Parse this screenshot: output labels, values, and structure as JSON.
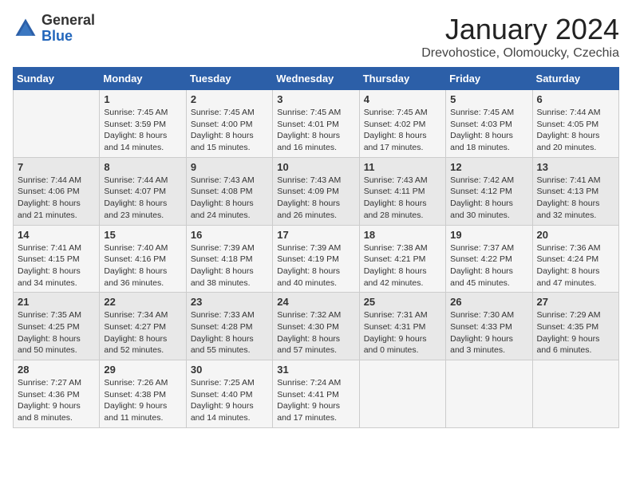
{
  "logo": {
    "general": "General",
    "blue": "Blue"
  },
  "title": "January 2024",
  "subtitle": "Drevohostice, Olomoucky, Czechia",
  "days_header": [
    "Sunday",
    "Monday",
    "Tuesday",
    "Wednesday",
    "Thursday",
    "Friday",
    "Saturday"
  ],
  "weeks": [
    [
      {
        "day": "",
        "detail": ""
      },
      {
        "day": "1",
        "detail": "Sunrise: 7:45 AM\nSunset: 3:59 PM\nDaylight: 8 hours\nand 14 minutes."
      },
      {
        "day": "2",
        "detail": "Sunrise: 7:45 AM\nSunset: 4:00 PM\nDaylight: 8 hours\nand 15 minutes."
      },
      {
        "day": "3",
        "detail": "Sunrise: 7:45 AM\nSunset: 4:01 PM\nDaylight: 8 hours\nand 16 minutes."
      },
      {
        "day": "4",
        "detail": "Sunrise: 7:45 AM\nSunset: 4:02 PM\nDaylight: 8 hours\nand 17 minutes."
      },
      {
        "day": "5",
        "detail": "Sunrise: 7:45 AM\nSunset: 4:03 PM\nDaylight: 8 hours\nand 18 minutes."
      },
      {
        "day": "6",
        "detail": "Sunrise: 7:44 AM\nSunset: 4:05 PM\nDaylight: 8 hours\nand 20 minutes."
      }
    ],
    [
      {
        "day": "7",
        "detail": "Sunrise: 7:44 AM\nSunset: 4:06 PM\nDaylight: 8 hours\nand 21 minutes."
      },
      {
        "day": "8",
        "detail": "Sunrise: 7:44 AM\nSunset: 4:07 PM\nDaylight: 8 hours\nand 23 minutes."
      },
      {
        "day": "9",
        "detail": "Sunrise: 7:43 AM\nSunset: 4:08 PM\nDaylight: 8 hours\nand 24 minutes."
      },
      {
        "day": "10",
        "detail": "Sunrise: 7:43 AM\nSunset: 4:09 PM\nDaylight: 8 hours\nand 26 minutes."
      },
      {
        "day": "11",
        "detail": "Sunrise: 7:43 AM\nSunset: 4:11 PM\nDaylight: 8 hours\nand 28 minutes."
      },
      {
        "day": "12",
        "detail": "Sunrise: 7:42 AM\nSunset: 4:12 PM\nDaylight: 8 hours\nand 30 minutes."
      },
      {
        "day": "13",
        "detail": "Sunrise: 7:41 AM\nSunset: 4:13 PM\nDaylight: 8 hours\nand 32 minutes."
      }
    ],
    [
      {
        "day": "14",
        "detail": "Sunrise: 7:41 AM\nSunset: 4:15 PM\nDaylight: 8 hours\nand 34 minutes."
      },
      {
        "day": "15",
        "detail": "Sunrise: 7:40 AM\nSunset: 4:16 PM\nDaylight: 8 hours\nand 36 minutes."
      },
      {
        "day": "16",
        "detail": "Sunrise: 7:39 AM\nSunset: 4:18 PM\nDaylight: 8 hours\nand 38 minutes."
      },
      {
        "day": "17",
        "detail": "Sunrise: 7:39 AM\nSunset: 4:19 PM\nDaylight: 8 hours\nand 40 minutes."
      },
      {
        "day": "18",
        "detail": "Sunrise: 7:38 AM\nSunset: 4:21 PM\nDaylight: 8 hours\nand 42 minutes."
      },
      {
        "day": "19",
        "detail": "Sunrise: 7:37 AM\nSunset: 4:22 PM\nDaylight: 8 hours\nand 45 minutes."
      },
      {
        "day": "20",
        "detail": "Sunrise: 7:36 AM\nSunset: 4:24 PM\nDaylight: 8 hours\nand 47 minutes."
      }
    ],
    [
      {
        "day": "21",
        "detail": "Sunrise: 7:35 AM\nSunset: 4:25 PM\nDaylight: 8 hours\nand 50 minutes."
      },
      {
        "day": "22",
        "detail": "Sunrise: 7:34 AM\nSunset: 4:27 PM\nDaylight: 8 hours\nand 52 minutes."
      },
      {
        "day": "23",
        "detail": "Sunrise: 7:33 AM\nSunset: 4:28 PM\nDaylight: 8 hours\nand 55 minutes."
      },
      {
        "day": "24",
        "detail": "Sunrise: 7:32 AM\nSunset: 4:30 PM\nDaylight: 8 hours\nand 57 minutes."
      },
      {
        "day": "25",
        "detail": "Sunrise: 7:31 AM\nSunset: 4:31 PM\nDaylight: 9 hours\nand 0 minutes."
      },
      {
        "day": "26",
        "detail": "Sunrise: 7:30 AM\nSunset: 4:33 PM\nDaylight: 9 hours\nand 3 minutes."
      },
      {
        "day": "27",
        "detail": "Sunrise: 7:29 AM\nSunset: 4:35 PM\nDaylight: 9 hours\nand 6 minutes."
      }
    ],
    [
      {
        "day": "28",
        "detail": "Sunrise: 7:27 AM\nSunset: 4:36 PM\nDaylight: 9 hours\nand 8 minutes."
      },
      {
        "day": "29",
        "detail": "Sunrise: 7:26 AM\nSunset: 4:38 PM\nDaylight: 9 hours\nand 11 minutes."
      },
      {
        "day": "30",
        "detail": "Sunrise: 7:25 AM\nSunset: 4:40 PM\nDaylight: 9 hours\nand 14 minutes."
      },
      {
        "day": "31",
        "detail": "Sunrise: 7:24 AM\nSunset: 4:41 PM\nDaylight: 9 hours\nand 17 minutes."
      },
      {
        "day": "",
        "detail": ""
      },
      {
        "day": "",
        "detail": ""
      },
      {
        "day": "",
        "detail": ""
      }
    ]
  ]
}
